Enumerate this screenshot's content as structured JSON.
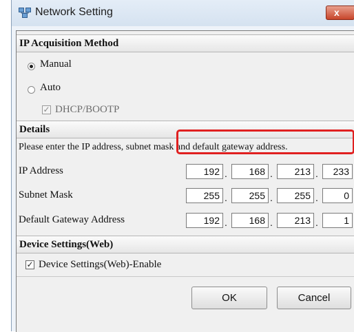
{
  "window": {
    "title": "Network Setting",
    "close_glyph": "x"
  },
  "ip_acquisition": {
    "heading": "IP Acquisition Method",
    "manual_label": "Manual",
    "auto_label": "Auto",
    "dhcp_label": "DHCP/BOOTP",
    "selected": "Manual"
  },
  "details": {
    "heading": "Details",
    "instructions": "Please enter the IP address, subnet mask and default gateway address.",
    "ip_address": {
      "label": "IP Address",
      "octets": [
        "192",
        "168",
        "213",
        "233"
      ]
    },
    "subnet_mask": {
      "label": "Subnet Mask",
      "octets": [
        "255",
        "255",
        "255",
        "0"
      ]
    },
    "default_gateway": {
      "label": "Default Gateway Address",
      "octets": [
        "192",
        "168",
        "213",
        "1"
      ]
    }
  },
  "device_settings": {
    "heading": "Device Settings(Web)",
    "enable_label": "Device Settings(Web)-Enable",
    "enabled": true
  },
  "buttons": {
    "ok": "OK",
    "cancel": "Cancel"
  },
  "colors": {
    "highlight": "#e02020",
    "close_button": "#c7452a"
  },
  "icons": {
    "title_icon": "network-settings-icon",
    "close": "close-icon"
  }
}
